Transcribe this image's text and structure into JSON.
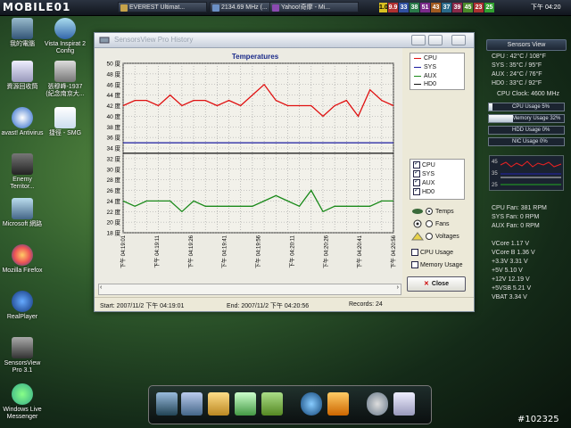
{
  "taskbar": {
    "logo": "MOBILE01",
    "tasks": [
      {
        "label": "EVEREST Ultimat..."
      },
      {
        "label": "2134.69 MHz (..."
      },
      {
        "label": "Yahoo!奇摩 - Mi..."
      }
    ],
    "tray_numbers": [
      "1.0",
      "9.9",
      "33",
      "38",
      "51",
      "43",
      "37",
      "39",
      "45",
      "23",
      "25"
    ],
    "clock": "下午 04:20"
  },
  "desktop": {
    "icons": [
      {
        "label": "我的電腦"
      },
      {
        "label": "Vista Inspirat 2 Config"
      },
      {
        "label": "資源回收筒"
      },
      {
        "label": "張穆峰-1937 (紀念南京大..."
      },
      {
        "label": "avast! Antivirus"
      },
      {
        "label": "捷徑 - SMG"
      },
      {
        "label": "Enemy Territor..."
      },
      {
        "label": "Microsoft 網路"
      },
      {
        "label": "Mozilla Firefox"
      },
      {
        "label": "RealPlayer"
      },
      {
        "label": "SensorsView Pro 3.1"
      },
      {
        "label": "Windows Live Messenger"
      }
    ]
  },
  "window": {
    "title": "SensorsView Pro History",
    "chart_title": "Temperatures",
    "status": {
      "start": "Start: 2007/11/2 下午 04:19:01",
      "end": "End: 2007/11/2 下午 04:20:56",
      "records": "Records: 24"
    },
    "legend": [
      {
        "name": "CPU",
        "color": "#e01010"
      },
      {
        "name": "SYS",
        "color": "#1a1aa0"
      },
      {
        "name": "AUX",
        "color": "#1a8a1a"
      },
      {
        "name": "HD0",
        "color": "#101010"
      }
    ],
    "checkboxes": [
      {
        "label": "CPU"
      },
      {
        "label": "SYS"
      },
      {
        "label": "AUX"
      },
      {
        "label": "HD0"
      }
    ],
    "radios": [
      {
        "label": "Temps",
        "selected": true
      },
      {
        "label": "Fans",
        "selected": false
      },
      {
        "label": "Voltages",
        "selected": false
      }
    ],
    "options": [
      {
        "label": "CPU Usage"
      },
      {
        "label": "Memory Usage"
      }
    ],
    "close_label": "Close"
  },
  "chart_data": {
    "type": "line",
    "title": "Temperatures",
    "ylim": [
      18,
      50
    ],
    "yticks": [
      "50 度",
      "48 度",
      "46 度",
      "44 度",
      "42 度",
      "40 度",
      "38 度",
      "36 度",
      "34 度",
      "32 度",
      "30 度",
      "28 度",
      "26 度",
      "24 度",
      "22 度",
      "20 度",
      "18 度"
    ],
    "x_labels": [
      "下午 04:19:01",
      "下午 04:19:11",
      "下午 04:19:26",
      "下午 04:19:41",
      "下午 04:19:56",
      "下午 04:20:11",
      "下午 04:20:26",
      "下午 04:20:41",
      "下午 04:20:56"
    ],
    "x_count": 24,
    "grid": true,
    "series": [
      {
        "name": "CPU",
        "color": "#e01010",
        "values": [
          42,
          43,
          43,
          42,
          44,
          42,
          43,
          43,
          42,
          43,
          42,
          44,
          46,
          43,
          42,
          42,
          42,
          40,
          42,
          43,
          40,
          45,
          43,
          42
        ]
      },
      {
        "name": "SYS",
        "color": "#1a1aa0",
        "values": [
          35,
          35,
          35,
          35,
          35,
          35,
          35,
          35,
          35,
          35,
          35,
          35,
          35,
          35,
          35,
          35,
          35,
          35,
          35,
          35,
          35,
          35,
          35,
          35
        ]
      },
      {
        "name": "AUX",
        "color": "#1a8a1a",
        "values": [
          24,
          23,
          24,
          24,
          24,
          22,
          24,
          23,
          23,
          23,
          23,
          23,
          24,
          25,
          24,
          23,
          26,
          22,
          23,
          23,
          23,
          23,
          24,
          24
        ]
      },
      {
        "name": "HD0",
        "color": "#101010",
        "values": [
          33,
          33,
          33,
          33,
          33,
          33,
          33,
          33,
          33,
          33,
          33,
          33,
          33,
          33,
          33,
          33,
          33,
          33,
          33,
          33,
          33,
          33,
          33,
          33
        ]
      }
    ]
  },
  "gadget": {
    "title": "Sensors View",
    "temps": [
      {
        "text": "CPU  : 42°C / 108°F"
      },
      {
        "text": "SYS  : 35°C / 95°F"
      },
      {
        "text": "AUX  : 24°C / 76°F"
      },
      {
        "text": "HD0  : 33°C / 92°F"
      }
    ],
    "cpu_clock": "CPU Clock: 4600 MHz",
    "bars": [
      {
        "label": "CPU Usage 5%",
        "fraction": 0.05
      },
      {
        "label": "Memory Usage 32%",
        "fraction": 0.32
      },
      {
        "label": "HDD Usage 0%",
        "fraction": 0.0
      },
      {
        "label": "NIC Usage 0%",
        "fraction": 0.0
      }
    ],
    "mini_ticks": [
      "45",
      "35",
      "25"
    ],
    "fans": [
      {
        "text": "CPU Fan: 381 RPM"
      },
      {
        "text": "SYS Fan: 0 RPM"
      },
      {
        "text": "AUX Fan: 0 RPM"
      }
    ],
    "volts": [
      {
        "text": "VCore 1.17 V"
      },
      {
        "text": "VCore B 1.36 V"
      },
      {
        "text": "+3.3V 3.31 V"
      },
      {
        "text": "+5V 5.10 V"
      },
      {
        "text": "+12V 12.19 V"
      },
      {
        "text": "+5VSB 5.21 V"
      },
      {
        "text": "VBAT 3.34 V"
      }
    ]
  },
  "watermark": "#102325"
}
